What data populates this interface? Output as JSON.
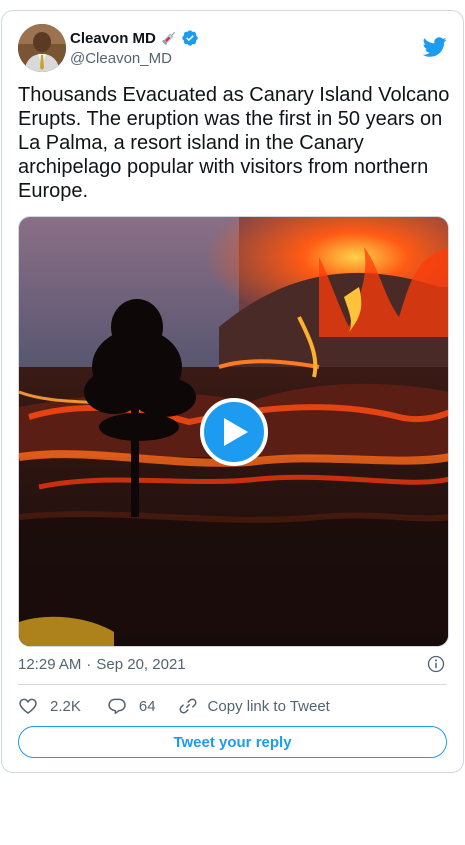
{
  "author": {
    "display_name": "Cleavon MD",
    "emoji_icon": "syringe-icon",
    "verified_icon": "verified-badge-icon",
    "handle": "@Cleavon_MD"
  },
  "brand": {
    "logo_icon": "twitter-bird-icon",
    "accent_color": "#1d9bf0"
  },
  "tweet": {
    "text": "Thousands Evacuated as Canary Island Volcano Erupts. The eruption was the first in 50 years on La Palma, a resort island in the Canary archipelago popular with visitors from northern Europe.",
    "media": {
      "type": "video",
      "play_icon": "play-icon"
    }
  },
  "meta": {
    "time": "12:29 AM",
    "separator": "·",
    "date": "Sep 20, 2021",
    "info_icon": "info-icon"
  },
  "actions": {
    "like_count": "2.2K",
    "reply_count": "64",
    "copy_link_label": "Copy link to Tweet"
  },
  "cta": {
    "reply_label": "Tweet your reply"
  }
}
